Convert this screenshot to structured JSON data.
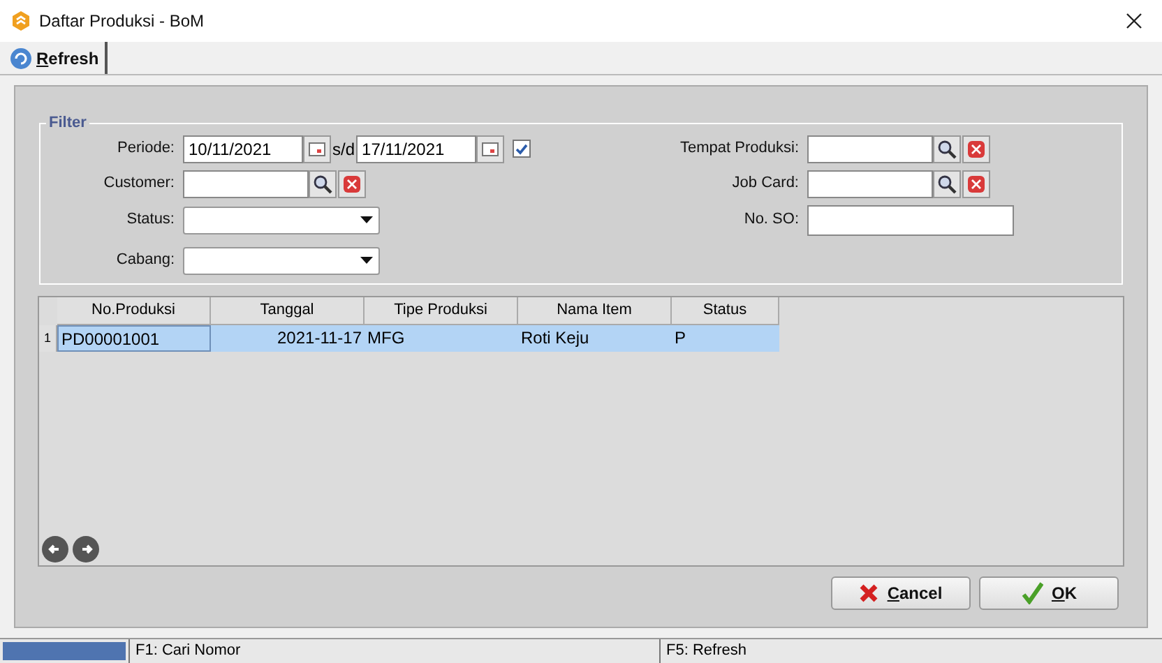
{
  "window": {
    "title": "Daftar Produksi - BoM"
  },
  "toolbar": {
    "refresh_button": "Refresh"
  },
  "filter": {
    "title": "Filter",
    "periode": {
      "label": "Periode:",
      "from": "10/11/2021",
      "separator": "s/d",
      "to": "17/11/2021",
      "checked": true
    },
    "customer": {
      "label": "Customer:"
    },
    "status": {
      "label": "Status:"
    },
    "cabang": {
      "label": "Cabang:"
    },
    "tempat_produksi": {
      "label": "Tempat Produksi:"
    },
    "job_card": {
      "label": "Job Card:"
    },
    "no_so": {
      "label": "No. SO:"
    }
  },
  "table": {
    "columns": [
      "No.Produksi",
      "Tanggal",
      "Tipe Produksi",
      "Nama Item",
      "Status"
    ],
    "rows": [
      {
        "number": "1",
        "selected": true,
        "cells": [
          "PD00001001",
          "2021-11-17",
          "MFG",
          "Roti Keju",
          "P"
        ]
      }
    ]
  },
  "buttons": [
    {
      "kind": "cancel",
      "label": "Cancel"
    },
    {
      "kind": "ok",
      "label": "OK"
    }
  ],
  "status_bar": [
    "F1: Cari Nomor",
    "F5: Refresh"
  ]
}
